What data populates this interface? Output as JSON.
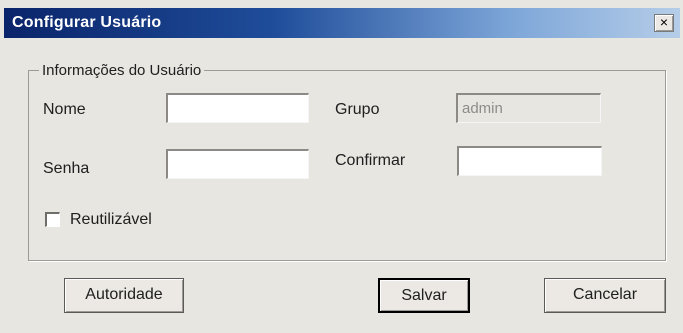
{
  "window": {
    "title": "Configurar Usuário",
    "close_glyph": "×"
  },
  "group": {
    "legend": "Informações do Usuário",
    "nome_label": "Nome",
    "nome_value": "",
    "grupo_label": "Grupo",
    "grupo_value": "admin",
    "senha_label": "Senha",
    "senha_value": "",
    "confirmar_label": "Confirmar",
    "confirmar_value": "",
    "reutilizavel_label": "Reutilizável",
    "reutilizavel_checked": false
  },
  "buttons": {
    "autoridade": "Autoridade",
    "salvar": "Salvar",
    "cancelar": "Cancelar"
  },
  "colors": {
    "titlebar_start": "#0a246a",
    "titlebar_end": "#b5cde8",
    "dialog_bg": "#e8e6e1"
  }
}
